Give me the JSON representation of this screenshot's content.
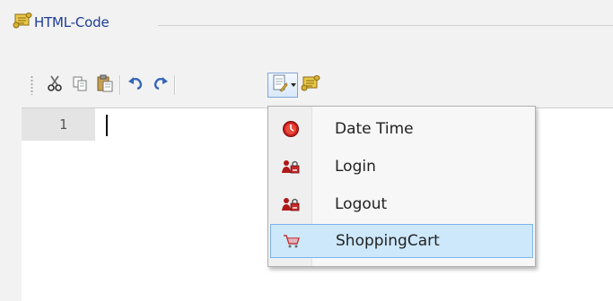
{
  "group": {
    "title": "HTML-Code",
    "title_color": "#1e3c96"
  },
  "toolbar": {
    "buttons": [
      {
        "name": "cut",
        "icon": "scissors-icon"
      },
      {
        "name": "copy",
        "icon": "copy-icon"
      },
      {
        "name": "paste",
        "icon": "paste-icon"
      },
      {
        "name": "undo",
        "icon": "undo-icon"
      },
      {
        "name": "redo",
        "icon": "redo-icon"
      },
      {
        "name": "insert-snippet-dropdown",
        "icon": "insert-snippet-icon"
      },
      {
        "name": "html-code",
        "icon": "scroll-icon"
      }
    ]
  },
  "editor": {
    "lines": [
      {
        "number": "1",
        "text": ""
      }
    ]
  },
  "menu": {
    "items": [
      {
        "label": "Date Time",
        "icon": "clock-icon",
        "selected": false
      },
      {
        "label": "Login",
        "icon": "user-lock-icon",
        "selected": false
      },
      {
        "label": "Logout",
        "icon": "user-lock-icon",
        "selected": false
      },
      {
        "label": "ShoppingCart",
        "icon": "shopping-cart-icon",
        "selected": true
      }
    ],
    "highlight_color": "#cde8fb"
  }
}
